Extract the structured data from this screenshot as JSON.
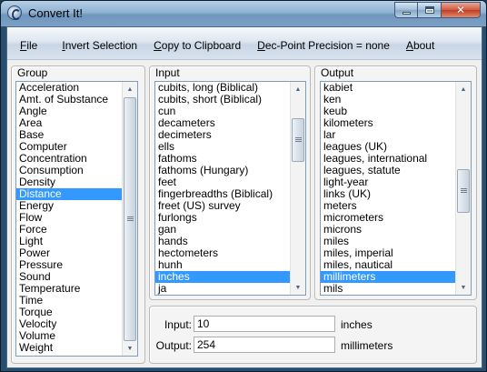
{
  "window": {
    "title": "Convert It!"
  },
  "titlebar_buttons": {
    "close": "✕"
  },
  "menu": [
    {
      "label": "File",
      "underline": "F",
      "rest": "ile"
    },
    {
      "label": "Invert Selection",
      "underline": "I",
      "rest": "nvert Selection"
    },
    {
      "label": "Copy to Clipboard",
      "underline": "C",
      "rest": "opy to Clipboard"
    },
    {
      "label": "Dec-Point Precision = none",
      "underline": "D",
      "rest": "ec-Point Precision = none"
    },
    {
      "label": "About",
      "underline": "A",
      "rest": "bout"
    }
  ],
  "group": {
    "title": "Group",
    "items": [
      "Acceleration",
      "Amt. of Substance",
      "Angle",
      "Area",
      "Base",
      "Computer",
      "Concentration",
      "Consumption",
      "Density",
      "Distance",
      "Energy",
      "Flow",
      "Force",
      "Light",
      "Power",
      "Pressure",
      "Sound",
      "Temperature",
      "Time",
      "Torque",
      "Velocity",
      "Volume",
      "Weight"
    ],
    "selected": "Distance"
  },
  "input": {
    "title": "Input",
    "items": [
      "cubits, long  (Biblical)",
      "cubits, short (Biblical)",
      "cun",
      "decameters",
      "decimeters",
      "ells",
      "fathoms",
      "fathoms (Hungary)",
      "feet",
      "fingerbreadths (Biblical)",
      "freet (US) survey",
      "furlongs",
      "gan",
      "hands",
      "hectometers",
      "hunh",
      "inches",
      "ja"
    ],
    "selected": "inches"
  },
  "output": {
    "title": "Output",
    "items": [
      "kabiet",
      "ken",
      "keub",
      "kilometers",
      "lar",
      "leagues (UK)",
      "leagues, international",
      "leagues, statute",
      "light-year",
      "links (UK)",
      "meters",
      "micrometers",
      "microns",
      "miles",
      "miles, imperial",
      "miles, nautical",
      "millimeters",
      "mils"
    ],
    "selected": "millimeters"
  },
  "conversion": {
    "input_label": "Input:",
    "input_value": "10",
    "input_unit": "inches",
    "output_label": "Output:",
    "output_value": "254",
    "output_unit": "millimeters"
  },
  "icons": {
    "app": "convert-it-app-icon",
    "scroll_up": "▲",
    "scroll_down": "▼"
  }
}
